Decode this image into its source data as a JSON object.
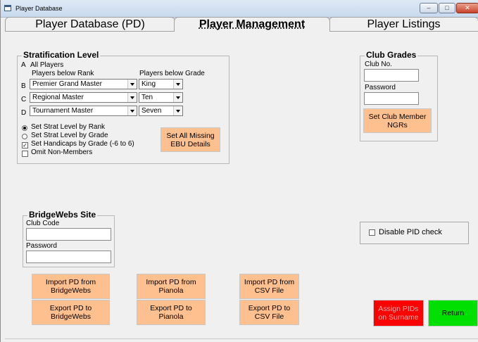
{
  "window": {
    "title": "Player Database",
    "buttons": {
      "minimize": "–",
      "maximize": "□",
      "close": "✕"
    }
  },
  "tabs": [
    {
      "label": "Player Database (PD)",
      "active": false
    },
    {
      "label": "Player Management",
      "active": true
    },
    {
      "label": "Player Listings",
      "active": false
    }
  ],
  "stratification": {
    "title": "Stratification Level",
    "row_a": {
      "letter": "A",
      "label": "All Players"
    },
    "col_rank": "Players below Rank",
    "col_grade": "Players below Grade",
    "rows": [
      {
        "letter": "B",
        "rank": "Premier Grand Master",
        "grade": "King"
      },
      {
        "letter": "C",
        "rank": "Regional Master",
        "grade": "Ten"
      },
      {
        "letter": "D",
        "rank": "Tournament Master",
        "grade": "Seven"
      }
    ],
    "opt_rank": "Set Strat Level by Rank",
    "opt_grade": "Set Strat Level by Grade",
    "chk_handicaps": "Set Handicaps by Grade (-6 to 6)",
    "chk_omit": "Omit Non-Members",
    "opt_rank_selected": true,
    "handicaps_checked": true,
    "omit_checked": false,
    "set_missing_button": "Set All Missing EBU Details"
  },
  "club_grades": {
    "title": "Club Grades",
    "club_no_label": "Club No.",
    "club_no_value": "",
    "password_label": "Password",
    "password_value": "",
    "button": "Set Club Member NGRs"
  },
  "bridgewebs": {
    "title": "BridgeWebs Site",
    "club_code_label": "Club Code",
    "club_code_value": "",
    "password_label": "Password",
    "password_value": ""
  },
  "disable_pid": {
    "label": "Disable PID check",
    "checked": false
  },
  "actions": {
    "import_bw": "Import PD from BridgeWebs",
    "export_bw": "Export PD to BridgeWebs",
    "import_pianola": "Import PD from Pianola",
    "export_pianola": "Export PD to Pianola",
    "import_csv": "Import PD from CSV File",
    "export_csv": "Export PD to CSV File",
    "assign_pids": "Assign PIDs on Surname",
    "return": "Return"
  },
  "colors": {
    "action_button": "#ffc090",
    "assign_button": "#ff0000",
    "return_button": "#00e000"
  }
}
